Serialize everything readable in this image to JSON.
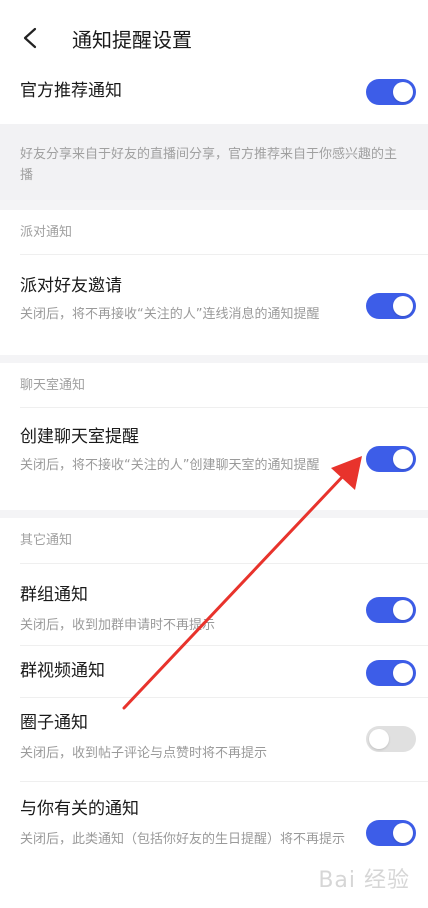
{
  "header": {
    "title": "通知提醒设置"
  },
  "official": {
    "label": "官方推荐通知",
    "on": true
  },
  "info_text": "好友分享来自于好友的直播间分享，官方推荐来自于你感兴趣的主播",
  "sections": {
    "party": {
      "title": "派对通知",
      "items": [
        {
          "label": "派对好友邀请",
          "desc": "关闭后，将不再接收“关注的人”连线消息的通知提醒",
          "on": true
        }
      ]
    },
    "chat": {
      "title": "聊天室通知",
      "items": [
        {
          "label": "创建聊天室提醒",
          "desc": "关闭后，将不接收“关注的人”创建聊天室的通知提醒",
          "on": true
        }
      ]
    },
    "other": {
      "title": "其它通知",
      "items": [
        {
          "label": "群组通知",
          "desc": "关闭后，收到加群申请时不再提示",
          "on": true
        },
        {
          "label": "群视频通知",
          "desc": "",
          "on": true
        },
        {
          "label": "圈子通知",
          "desc": "关闭后，收到帖子评论与点赞时将不再提示",
          "on": false
        },
        {
          "label": "与你有关的通知",
          "desc": "关闭后，此类通知（包括你好友的生日提醒）将不再提示",
          "on": true
        }
      ]
    }
  },
  "watermark": "Bai 经验",
  "colors": {
    "toggle_on": "#3d5de8",
    "toggle_off": "#e0e0e0",
    "arrow": "#e8332c"
  }
}
